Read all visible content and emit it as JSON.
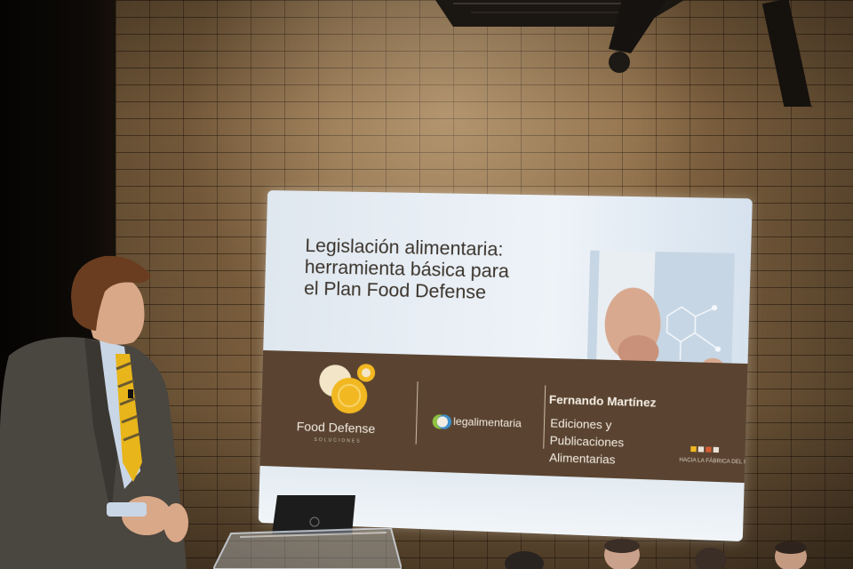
{
  "slide": {
    "title_lines": [
      "Legislación alimentaria:",
      "herramienta básica para",
      "el Plan Food Defense"
    ],
    "food_defense_logo": {
      "name": "Food Defense",
      "tagline": "SOLUCIONES"
    },
    "legal_logo": {
      "text": "legalimentaria"
    },
    "speaker_name": "Fernando Martínez",
    "organization_lines": [
      "Ediciones y",
      "Publicaciones",
      "Alimentarias"
    ],
    "corner_logo_text": "HACIA LA FÁBRICA DEL FUTURO"
  },
  "colors": {
    "slide_band": "#5a4431",
    "slide_light": "#e8eef4",
    "brick": "#8a6a45",
    "logo_yellow": "#f2b822",
    "logo_cream": "#f3e6c8",
    "tie_yellow": "#e8b51a"
  },
  "laptop_brand_icon": "dell-logo-icon"
}
